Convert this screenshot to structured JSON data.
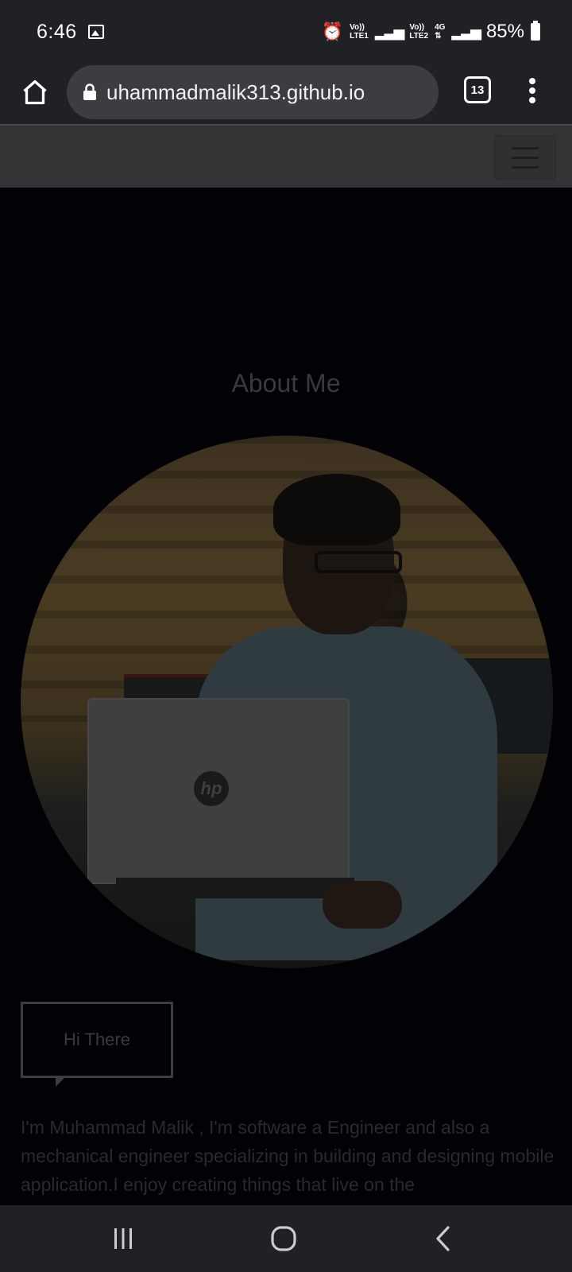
{
  "status_bar": {
    "time": "6:46",
    "sim1": [
      "Vo))",
      "LTE1"
    ],
    "sim2": [
      "Vo))",
      "LTE2"
    ],
    "network": "4G",
    "battery": "85%"
  },
  "browser": {
    "url": "uhammadmalik313.github.io",
    "tab_count": "13"
  },
  "page": {
    "section_title": "About Me",
    "bubble_text": "Hi There",
    "paragraph": "I'm Muhammad Malik , I'm software a Engineer and also a mechanical engineer specializing in building and designing mobile application.I enjoy creating things that live on the"
  },
  "colors": {
    "chrome_bg": "#202124",
    "navbar_bg": "#343436",
    "page_bg": "#020206"
  },
  "icons": {
    "home": "home-icon",
    "lock": "lock-icon",
    "menu": "more-vert-icon",
    "hamburger": "hamburger-icon",
    "recents": "recents-icon",
    "home_nav": "home-nav-icon",
    "back": "back-icon"
  }
}
